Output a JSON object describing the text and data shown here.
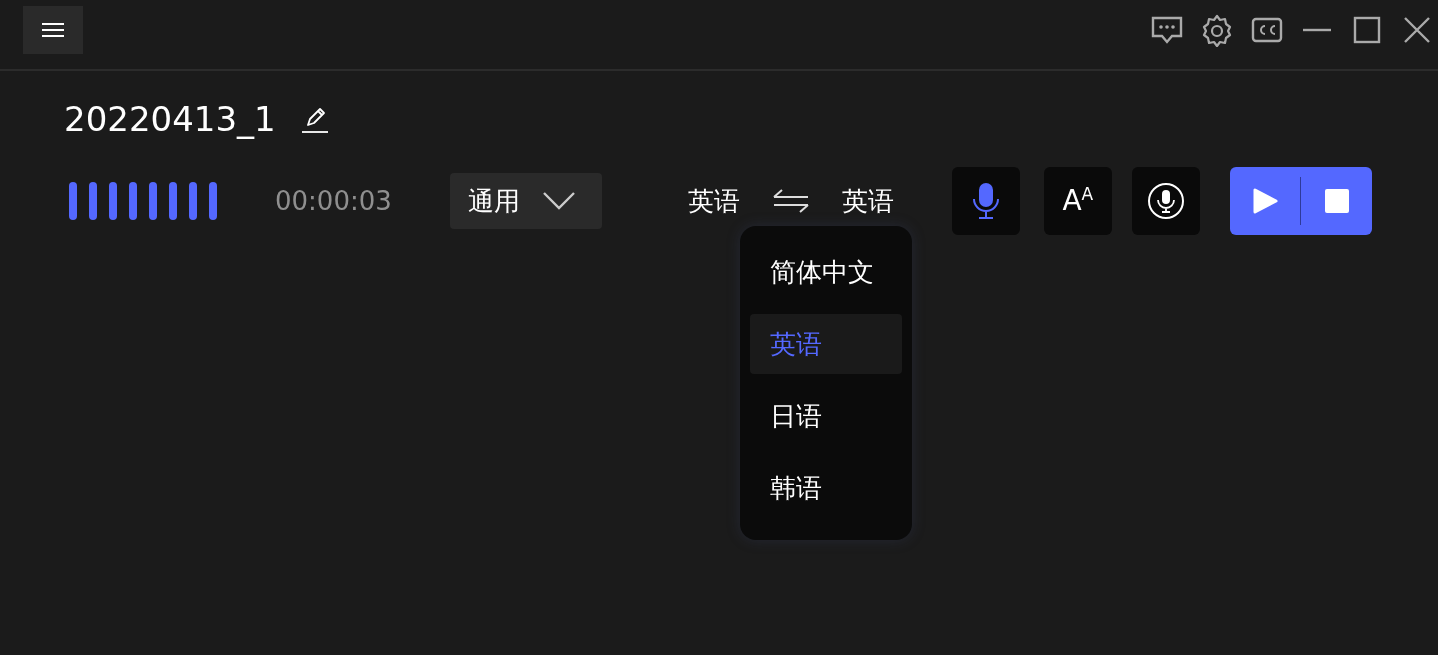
{
  "recording": {
    "title": "20220413_1",
    "elapsed": "00:00:03"
  },
  "scene": {
    "value": "通用",
    "expanded": false
  },
  "languages": {
    "source": "英语",
    "target": "英语"
  },
  "language_menu": {
    "open": true,
    "items": [
      {
        "label": "简体中文",
        "selected": false
      },
      {
        "label": "英语",
        "selected": true
      },
      {
        "label": "日语",
        "selected": false
      },
      {
        "label": "韩语",
        "selected": false
      }
    ]
  },
  "tools": [
    {
      "kind": "mic",
      "active": true
    },
    {
      "kind": "font",
      "label": "A$^{A}$"
    },
    {
      "kind": "voice",
      "active": false
    }
  ]
}
